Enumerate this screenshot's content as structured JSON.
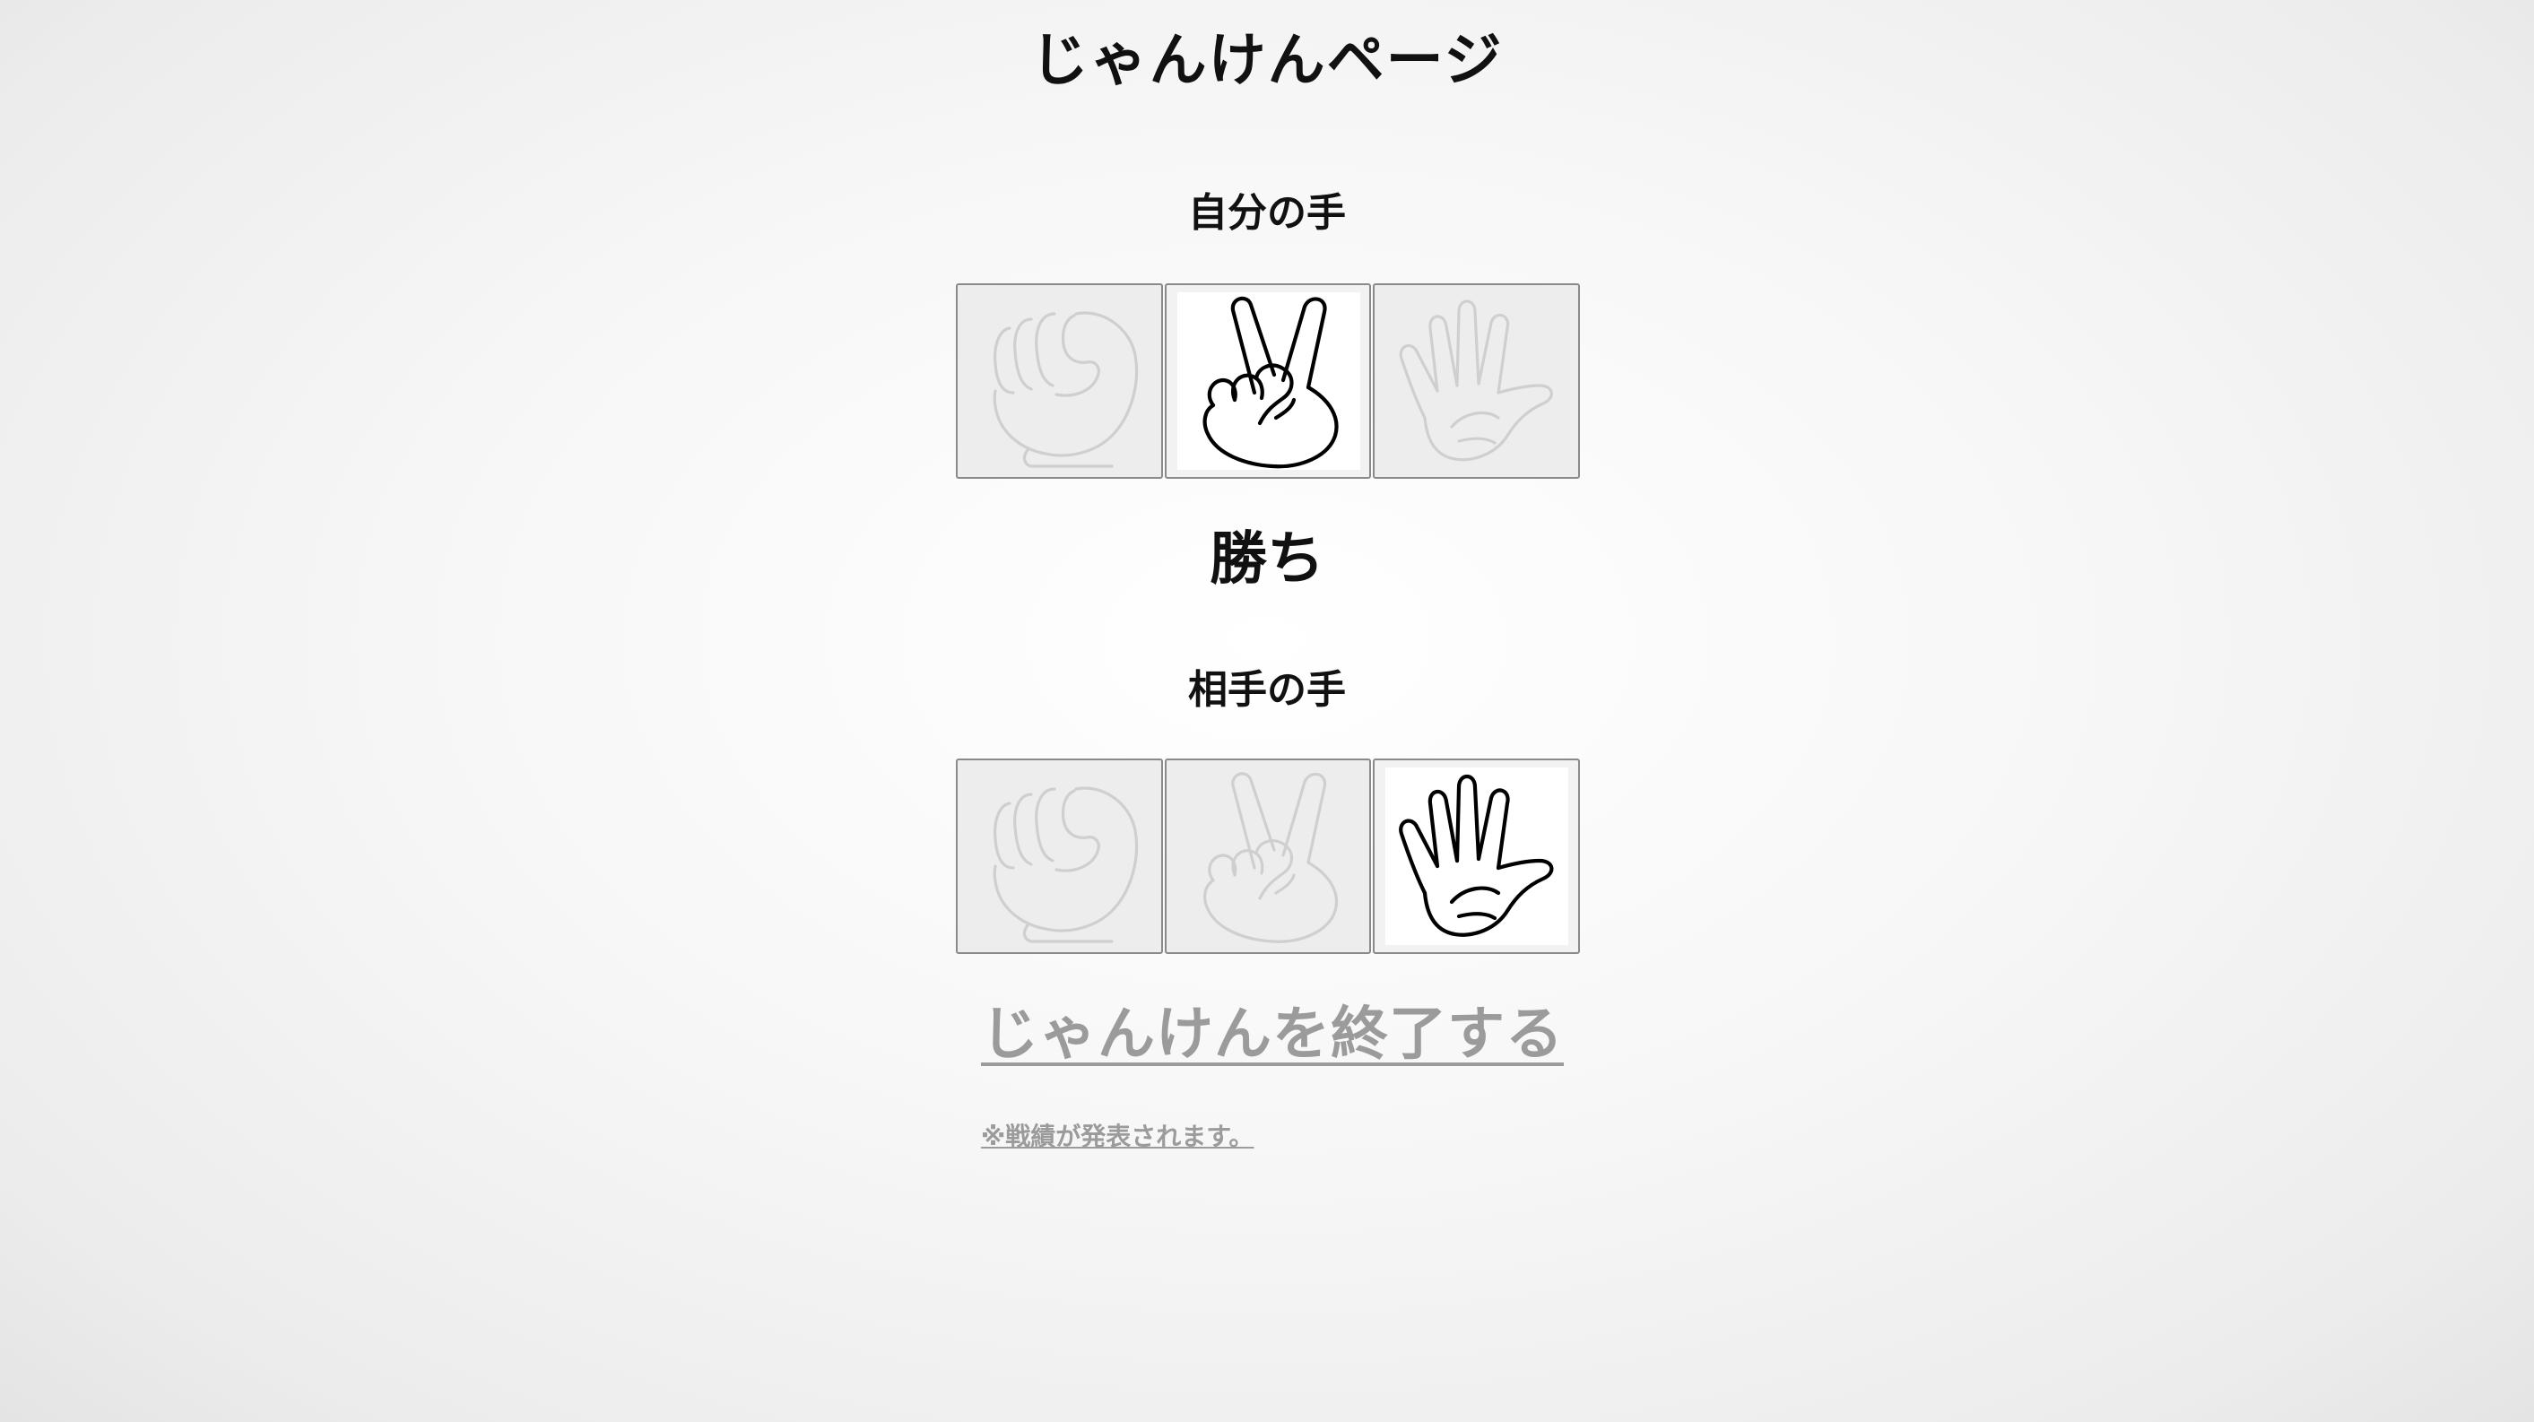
{
  "page": {
    "title": "じゃんけんページ"
  },
  "my_hand": {
    "label": "自分の手",
    "options": [
      {
        "name": "rock",
        "icon": "fist-icon",
        "selected": false
      },
      {
        "name": "scissors",
        "icon": "peace-sign-icon",
        "selected": true
      },
      {
        "name": "paper",
        "icon": "open-palm-icon",
        "selected": false
      }
    ]
  },
  "result": {
    "text": "勝ち"
  },
  "opponent_hand": {
    "label": "相手の手",
    "options": [
      {
        "name": "rock",
        "icon": "fist-icon",
        "selected": false
      },
      {
        "name": "scissors",
        "icon": "peace-sign-icon",
        "selected": false
      },
      {
        "name": "paper",
        "icon": "open-palm-icon",
        "selected": true
      }
    ]
  },
  "footer": {
    "end_link": "じゃんけんを終了する",
    "note": "※戦績が発表されます。"
  },
  "colors": {
    "active_stroke": "#000000",
    "inactive_stroke": "#cfcfcf",
    "link_gray": "#9b9b9b"
  }
}
